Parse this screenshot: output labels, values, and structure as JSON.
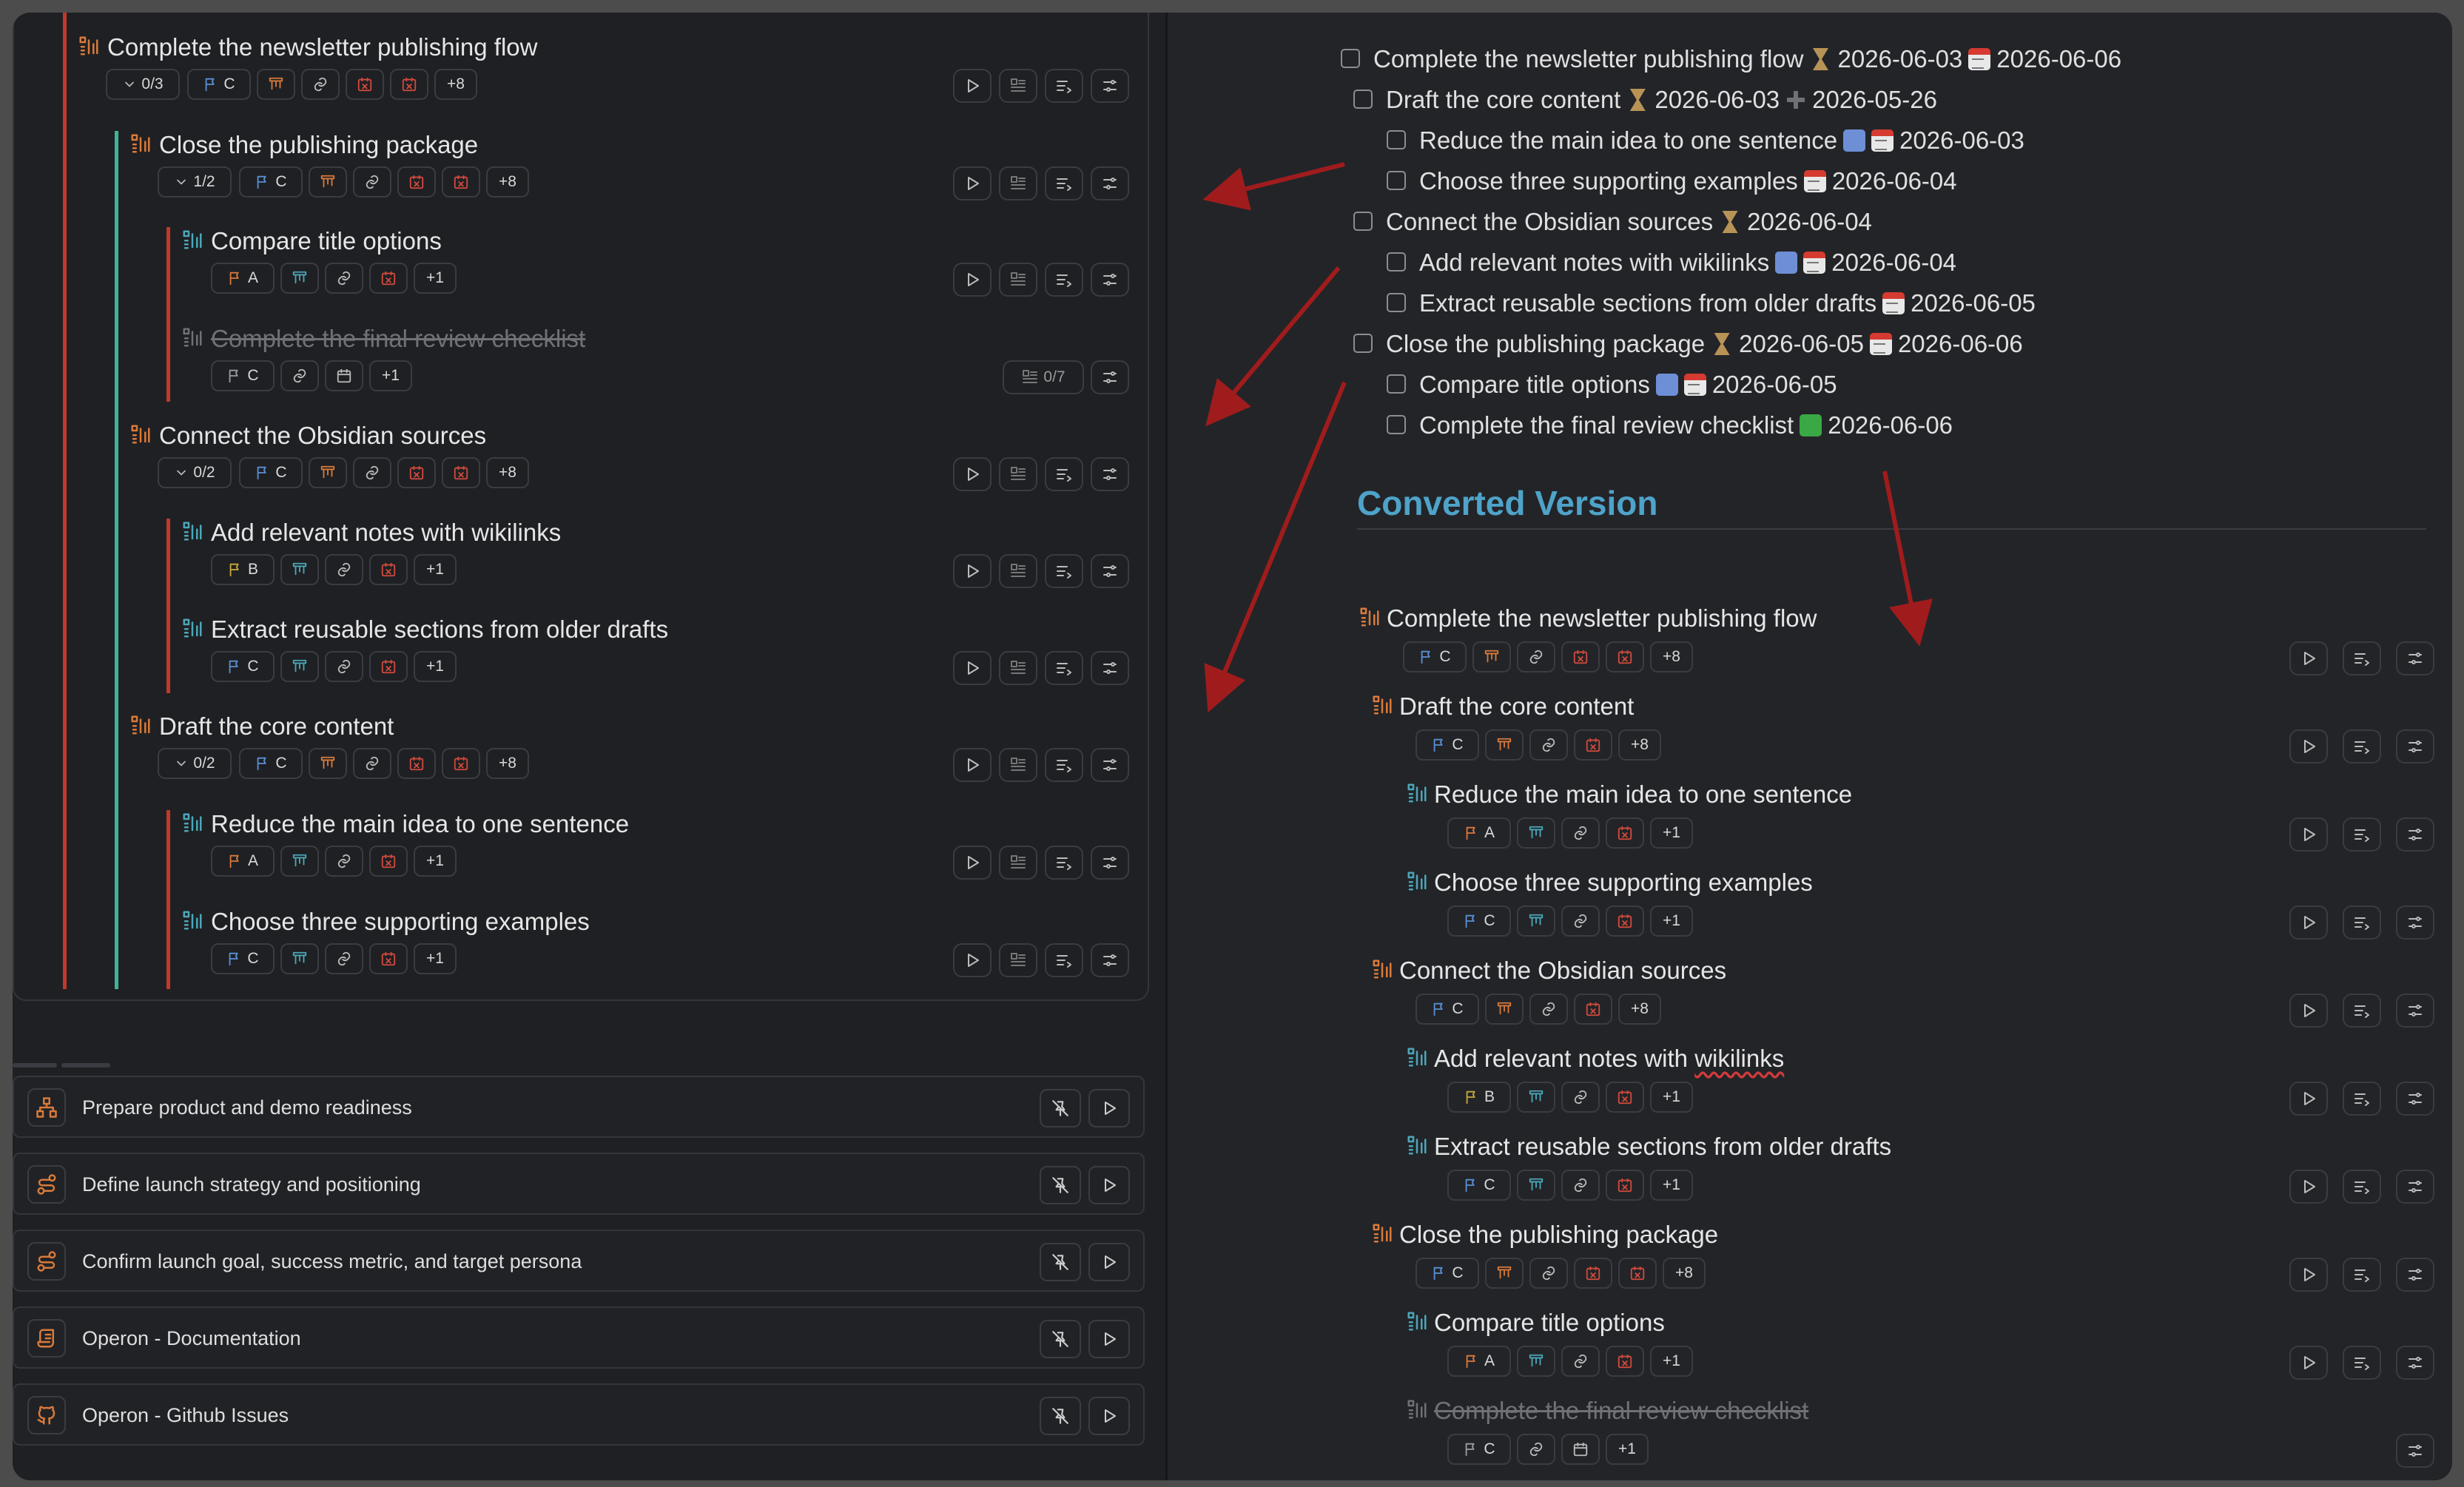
{
  "left_panel": {
    "tasks": [
      {
        "title": "Complete the newsletter publishing flow",
        "progress": "0/3",
        "priority": "C",
        "more": "+8"
      },
      {
        "title": "Close the publishing package",
        "progress": "1/2",
        "priority": "C",
        "more": "+8"
      },
      {
        "title": "Compare title options",
        "priority": "A",
        "more": "+1"
      },
      {
        "title": "Complete the final review checklist",
        "priority": "C",
        "more": "+1",
        "subtasks": "0/7"
      },
      {
        "title": "Connect the Obsidian sources",
        "progress": "0/2",
        "priority": "C",
        "more": "+8"
      },
      {
        "title": "Add relevant notes with wikilinks",
        "priority": "B",
        "more": "+1"
      },
      {
        "title": "Extract reusable sections from older drafts",
        "priority": "C",
        "more": "+1"
      },
      {
        "title": "Draft the core content",
        "progress": "0/2",
        "priority": "C",
        "more": "+8"
      },
      {
        "title": "Reduce the main idea to one sentence",
        "priority": "A",
        "more": "+1"
      },
      {
        "title": "Choose three supporting examples",
        "priority": "C",
        "more": "+1"
      }
    ],
    "projects": [
      {
        "label": "Prepare product and demo readiness",
        "icon": "network-icon"
      },
      {
        "label": "Define launch strategy and positioning",
        "icon": "route-icon"
      },
      {
        "label": "Confirm launch goal, success metric, and target persona",
        "icon": "route-icon"
      },
      {
        "label": "Operon - Documentation",
        "icon": "scroll-icon"
      },
      {
        "label": "Operon - Github Issues",
        "icon": "github-icon"
      }
    ]
  },
  "right_panel": {
    "markdown": [
      {
        "text": "Complete the newsletter publishing flow",
        "start": "2026-06-03",
        "due": "2026-06-06"
      },
      {
        "text": "Draft the core content",
        "start": "2026-06-03",
        "created": "2026-05-26"
      },
      {
        "text": "Reduce the main idea to one sentence",
        "due": "2026-06-03"
      },
      {
        "text": "Choose three supporting examples",
        "due": "2026-06-04"
      },
      {
        "text": "Connect the Obsidian sources",
        "start": "2026-06-04"
      },
      {
        "text": "Add relevant notes with wikilinks",
        "due": "2026-06-04"
      },
      {
        "text": "Extract reusable sections from older drafts",
        "due": "2026-06-05"
      },
      {
        "text": "Close the publishing package",
        "start": "2026-06-05",
        "due": "2026-06-06"
      },
      {
        "text": "Compare title options",
        "due": "2026-06-05"
      },
      {
        "text": "Complete the final review checklist",
        "done": "2026-06-06"
      }
    ],
    "heading": "Converted Version",
    "converted": [
      {
        "title": "Complete the newsletter publishing flow",
        "priority": "C",
        "more": "+8"
      },
      {
        "title": "Draft the core content",
        "priority": "C",
        "more": "+8"
      },
      {
        "title": "Reduce the main idea to one sentence",
        "priority": "A",
        "more": "+1"
      },
      {
        "title": "Choose three supporting examples",
        "priority": "C",
        "more": "+1"
      },
      {
        "title": "Connect the Obsidian sources",
        "priority": "C",
        "more": "+8"
      },
      {
        "title_prefix": "Add relevant notes with ",
        "title_link": "wikilinks",
        "priority": "B",
        "more": "+1"
      },
      {
        "title": "Extract reusable sections from older drafts",
        "priority": "C",
        "more": "+1"
      },
      {
        "title": "Close the publishing package",
        "priority": "C",
        "more": "+8"
      },
      {
        "title": "Compare title options",
        "priority": "A",
        "more": "+1"
      },
      {
        "title": "Complete the final review checklist",
        "priority": "C",
        "more": "+1"
      }
    ]
  },
  "colors": {
    "parent_line": "#c0392b",
    "child_line": "#3fb39a",
    "arrow": "#a01c1c",
    "heading": "#4ea3c9"
  }
}
